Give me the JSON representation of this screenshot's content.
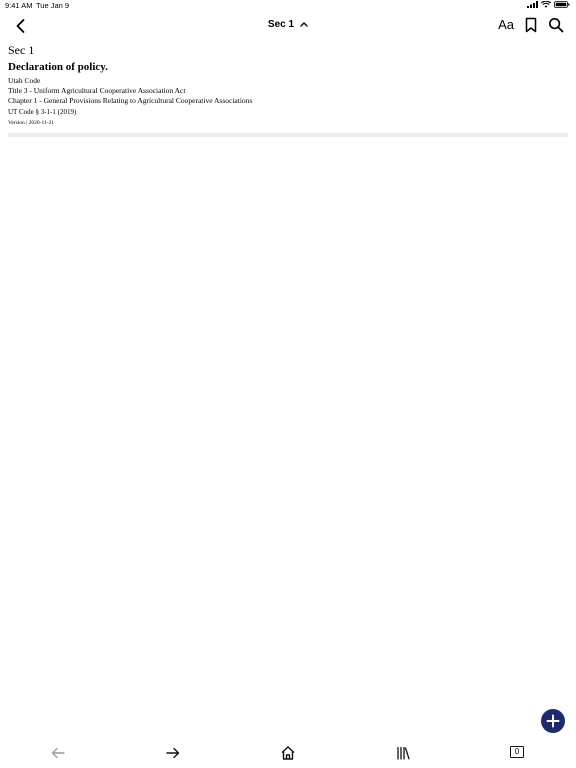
{
  "status_bar": {
    "time": "9:41 AM",
    "date": "Tue Jan 9"
  },
  "nav": {
    "title": "Sec 1",
    "font_button_label": "Aa"
  },
  "document": {
    "section": "Sec 1",
    "heading": "Declaration of policy.",
    "source": "Utah Code",
    "title_line": "Title 3 - Uniform Agricultural Cooperative Association Act",
    "chapter_line": "Chapter 1 - General Provisions Relating to Agricultural Cooperative Associations",
    "code_ref": "UT Code § 3-1-1 (2019)",
    "version": "Version | 2020-11-21"
  },
  "toolbar": {
    "tab_count": "0"
  },
  "colors": {
    "fab": "#1f2a6b",
    "divider": "#ececec",
    "disabled": "#9a9a9a"
  },
  "icons": [
    "back-chevron-icon",
    "chevron-up-icon",
    "bookmark-icon",
    "search-icon",
    "plus-icon",
    "back-arrow-icon",
    "forward-arrow-icon",
    "home-icon",
    "library-icon",
    "tabs-icon",
    "signal-icon",
    "wifi-icon",
    "battery-icon"
  ]
}
